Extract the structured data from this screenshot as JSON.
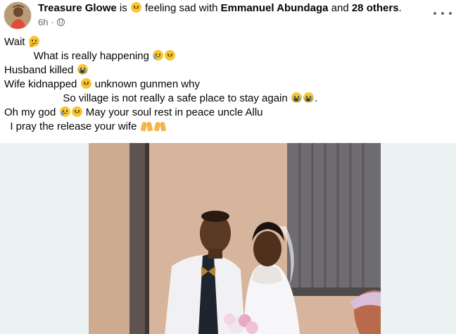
{
  "post": {
    "author": "Treasure Glowe",
    "feeling_prefix": "is",
    "feeling_emoji": "sad-face",
    "feeling_text": "feeling sad with",
    "tagged_person": "Emmanuel Abundaga",
    "tagged_joiner": "and",
    "tagged_others": "28 others",
    "tagged_suffix": ".",
    "time": "6h",
    "time_sep": "·",
    "privacy_icon": "globe-icon",
    "lines": [
      {
        "indent": "",
        "text": "Wait",
        "emojis": [
          "thinking"
        ]
      },
      {
        "indent": "     ",
        "text": "What is really happening",
        "emojis": [
          "crying-sad",
          "sad-face"
        ]
      },
      {
        "indent": "",
        "text": "Husband killed",
        "emojis": [
          "loudly-crying"
        ]
      },
      {
        "indent": "",
        "text": "Wife kidnapped",
        "emojis": [
          "sad-face"
        ],
        "after": "unknown gunmen why"
      },
      {
        "indent": "          ",
        "text": "So village is not really a safe place to stay again",
        "emojis": [
          "loudly-crying",
          "loudly-crying"
        ],
        "after": "."
      },
      {
        "indent": "",
        "text": "Oh my god",
        "emojis": [
          "crying-sad",
          "sad-face"
        ],
        "after": "May your soul rest in peace uncle Allu"
      },
      {
        "indent": " ",
        "text": "I pray the release your wife",
        "emojis": [
          "folded-hands",
          "folded-hands"
        ]
      }
    ]
  },
  "photo": {
    "description_icon": "wedding-photo",
    "background_color": "#ecf1f2"
  }
}
